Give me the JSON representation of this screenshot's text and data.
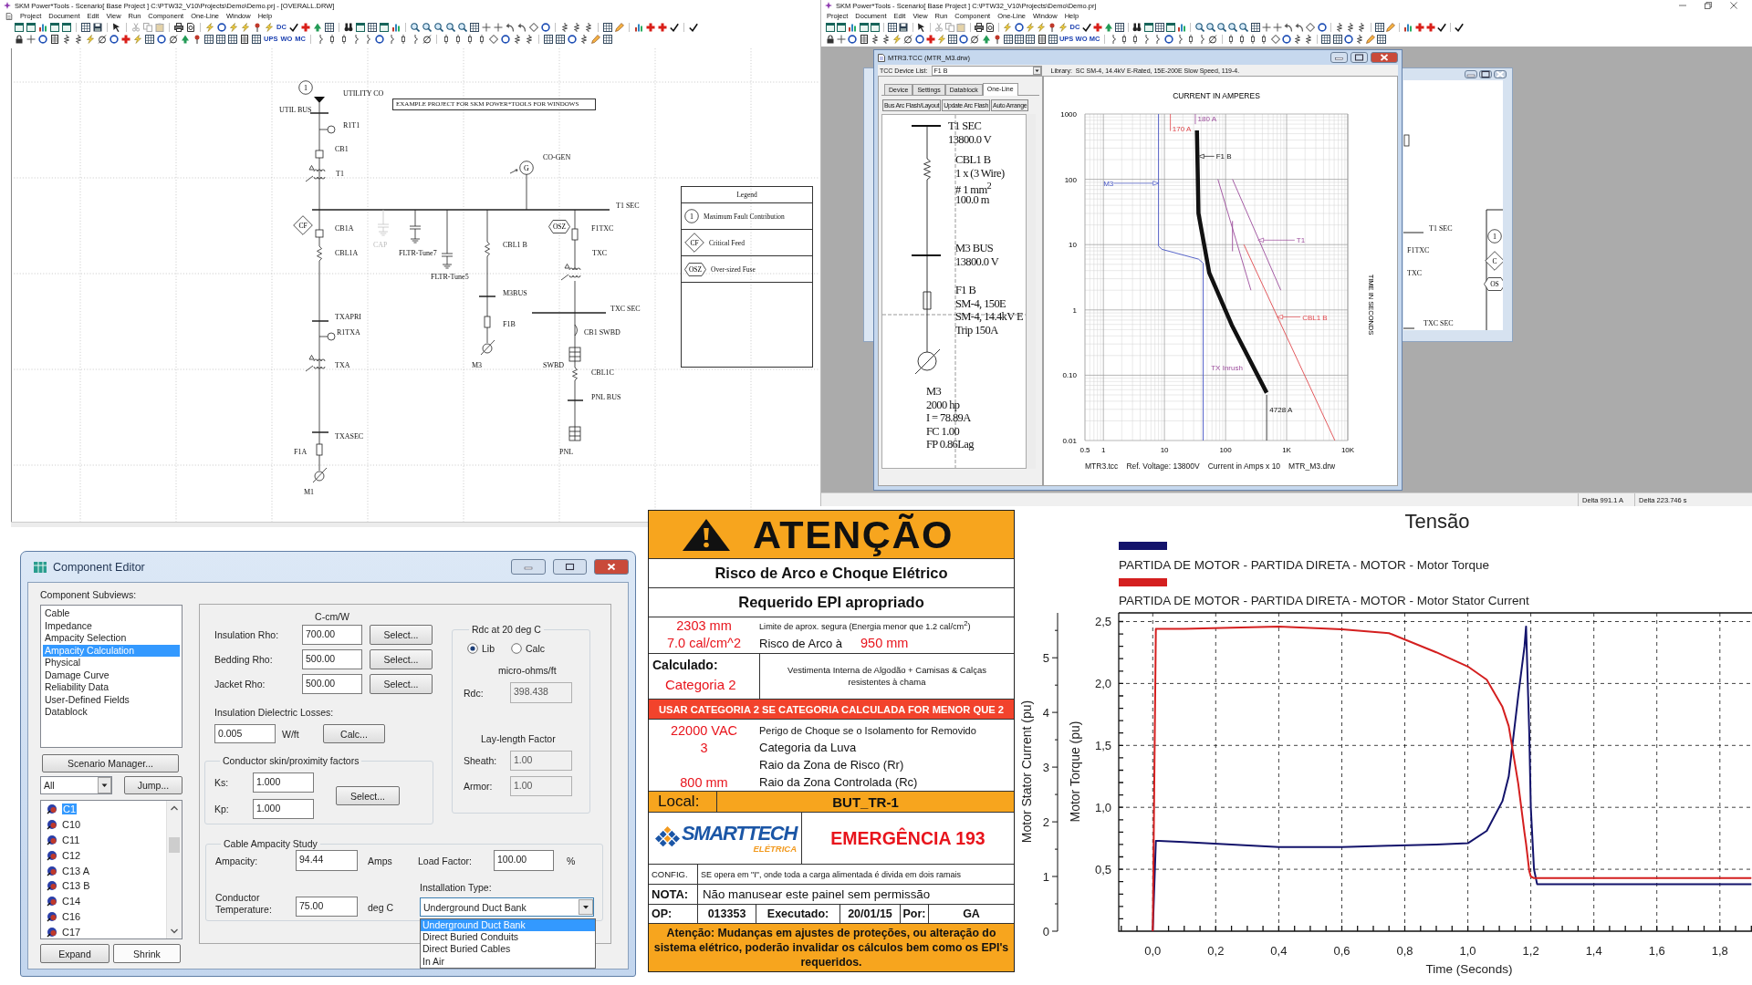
{
  "one_line_window": {
    "title": "SKM Power*Tools - Scenario[ Base Project ] C:\\PTW32_V10\\Projects\\Demo\\Demo.prj - [OVERALL.DRW]",
    "menu": [
      "Project",
      "Document",
      "Edit",
      "View",
      "Run",
      "Component",
      "One-Line",
      "Window",
      "Help"
    ],
    "toolbar": {
      "row_1_text_buttons": [
        "DC"
      ],
      "row_2_text_buttons": [
        "UPS",
        "WO",
        "MC"
      ]
    },
    "note": "EXAMPLE PROJECT FOR SKM POWER*TOOLS FOR WINDOWS",
    "tags": [
      {
        "kind": "fault",
        "text": "1"
      },
      {
        "kind": "critical",
        "text": "CF"
      },
      {
        "kind": "oversized",
        "text": "OSZ"
      },
      {
        "kind": "generator",
        "text": "G"
      }
    ],
    "labels": [
      {
        "text": "UTILITY CO",
        "disabled": false
      },
      {
        "text": "UTIL BUS",
        "disabled": false
      },
      {
        "text": "R1T1",
        "disabled": false
      },
      {
        "text": "CB1",
        "disabled": false
      },
      {
        "text": "T1",
        "disabled": false
      },
      {
        "text": "CO-GEN",
        "disabled": false
      },
      {
        "text": "T1 SEC",
        "disabled": false
      },
      {
        "text": "CB1A",
        "disabled": false
      },
      {
        "text": "CBL1A",
        "disabled": false
      },
      {
        "text": "CAP",
        "disabled": true
      },
      {
        "text": "FLTR-Tune7",
        "disabled": false
      },
      {
        "text": "FLTR-Tune5",
        "disabled": false
      },
      {
        "text": "CBL1 B",
        "disabled": false
      },
      {
        "text": "M3BUS",
        "disabled": false
      },
      {
        "text": "F1B",
        "disabled": false
      },
      {
        "text": "M3",
        "disabled": false
      },
      {
        "text": "F1TXC",
        "disabled": false
      },
      {
        "text": "TXC",
        "disabled": false
      },
      {
        "text": "TXC SEC",
        "disabled": false
      },
      {
        "text": "CB1 SWBD",
        "disabled": false
      },
      {
        "text": "SWBD",
        "disabled": false
      },
      {
        "text": "CBL1C",
        "disabled": false
      },
      {
        "text": "PNL BUS",
        "disabled": false
      },
      {
        "text": "PNL",
        "disabled": false
      },
      {
        "text": "TXAPRI",
        "disabled": false
      },
      {
        "text": "R1TXA",
        "disabled": false
      },
      {
        "text": "TXA",
        "disabled": false
      },
      {
        "text": "TXASEC",
        "disabled": false
      },
      {
        "text": "F1A",
        "disabled": false
      },
      {
        "text": "M1",
        "disabled": false
      }
    ],
    "legend": {
      "title": "Legend",
      "items": [
        {
          "kind": "fault",
          "tag": "1",
          "text": "Maximum Fault Contribution"
        },
        {
          "kind": "critical",
          "tag": "CF",
          "text": "Critical Feed"
        },
        {
          "kind": "oversized",
          "tag": "OSZ",
          "text": "Over-sized Fuse"
        }
      ]
    }
  },
  "tcc_window": {
    "title": "SKM Power*Tools - Scenario[ Base Project ] C:\\PTW32_V10\\Projects\\Demo\\Demo.prj",
    "menu": [
      "Project",
      "Document",
      "Edit",
      "View",
      "Run",
      "Component",
      "One-Line",
      "Window",
      "Help"
    ],
    "toolbar": {
      "row_1_text_buttons": [
        "DC"
      ],
      "row_2_text_buttons": [
        "UPS",
        "WO",
        "MC"
      ]
    },
    "side_window": {
      "labels": [
        "T1 SEC",
        "F1TXC",
        "TXC",
        "TXC SEC"
      ],
      "tags": [
        {
          "kind": "fault",
          "text": "1"
        },
        {
          "kind": "critical",
          "text": "C"
        },
        {
          "kind": "oversized",
          "text": "OS"
        }
      ]
    },
    "tcc": {
      "title": "MTR3.TCC (MTR_M3.drw)",
      "device_list_label": "TCC Device List:",
      "device": "F1 B",
      "library_label": "Library:",
      "library": "SC SM-4, 14.4kV E-Rated, 15E-200E Slow Speed, 119-4.",
      "tabs": [
        {
          "label": "Device",
          "selected": false
        },
        {
          "label": "Settings",
          "selected": false
        },
        {
          "label": "Datablock",
          "selected": false
        },
        {
          "label": "One-Line",
          "selected": true
        }
      ],
      "buttons": [
        "Bus Arc Flash/Layout",
        "Update Arc Flash",
        "Auto Arrange"
      ],
      "one_line": [
        {
          "kind": "bus",
          "lines": [
            "T1 SEC",
            "13800.0 V"
          ]
        },
        {
          "kind": "cable",
          "lines": [
            "CBL1 B",
            "1 x (3 Wire)",
            "# 1 mm$^{2}$",
            "100.0 m"
          ]
        },
        {
          "kind": "bus",
          "lines": [
            "M3 BUS",
            "13800.0 V"
          ]
        },
        {
          "kind": "fuse",
          "lines": [
            "F1 B",
            "SM-4, 150E",
            "SM-4, 14.4kV E",
            "Trip 150A"
          ]
        },
        {
          "kind": "motor",
          "lines": [
            "M3",
            "2000 hp",
            "I = 78.89A",
            "FC 1.00",
            "FP 0.86Lag"
          ]
        }
      ],
      "tcc_plot": {
        "title": "CURRENT IN AMPERES",
        "axis_title": "TIME IN SECONDS",
        "x_tick_labels": [
          "0.5",
          "1",
          "10",
          "100",
          "1K",
          "10K"
        ],
        "y_tick_labels": [
          "1000",
          "100",
          "10",
          "1",
          "0.10",
          "0.01"
        ],
        "curves": [
          {
            "label": "180 A",
            "kind": "marker"
          },
          {
            "label": "170 A",
            "kind": "marker"
          },
          {
            "label": "F1 B",
            "kind": "band"
          },
          {
            "label": "M3",
            "kind": "line"
          },
          {
            "label": "T1",
            "kind": "line"
          },
          {
            "label": "CBL1 B",
            "kind": "line"
          },
          {
            "label": "TX Inrush",
            "kind": "line"
          },
          {
            "label": "4728 A",
            "kind": "marker"
          }
        ]
      },
      "footer": [
        "MTR3.tcc",
        "Ref. Voltage: 13800V",
        "Current in Amps x 10",
        "MTR_M3.drw"
      ]
    },
    "status_bar": [
      "Delta 991.1 A",
      "Delta 223.746 s"
    ]
  },
  "component_editor": {
    "title": "Component Editor",
    "subviews_label": "Component Subviews:",
    "subviews": [
      {
        "label": "Cable",
        "selected": false
      },
      {
        "label": "Impedance",
        "selected": false
      },
      {
        "label": "Ampacity Selection",
        "selected": false
      },
      {
        "label": "Ampacity Calculation",
        "selected": true
      },
      {
        "label": "Physical",
        "selected": false
      },
      {
        "label": "Damage Curve",
        "selected": false
      },
      {
        "label": "Reliability Data",
        "selected": false
      },
      {
        "label": "User-Defined Fields",
        "selected": false
      },
      {
        "label": "Datablock",
        "selected": false
      }
    ],
    "scenario_button": "Scenario Manager...",
    "filter": "All",
    "jump_button": "Jump...",
    "components": [
      {
        "label": "C1",
        "selected": true
      },
      {
        "label": "C10",
        "selected": false
      },
      {
        "label": "C11",
        "selected": false
      },
      {
        "label": "C12",
        "selected": false
      },
      {
        "label": "C13 A",
        "selected": false
      },
      {
        "label": "C13 B",
        "selected": false
      },
      {
        "label": "C14",
        "selected": false
      },
      {
        "label": "C16",
        "selected": false
      },
      {
        "label": "C17",
        "selected": false
      }
    ],
    "expand_button": "Expand",
    "shrink_button": "Shrink",
    "unit_header": "C-cm/W",
    "rho_rows": [
      {
        "label": "Insulation Rho:",
        "value": "700.00",
        "button": "Select..."
      },
      {
        "label": "Bedding Rho:",
        "value": "500.00",
        "button": "Select..."
      },
      {
        "label": "Jacket Rho:",
        "value": "500.00",
        "button": "Select..."
      }
    ],
    "dielectric": {
      "label": "Insulation Dielectric Losses:",
      "value": "0.005",
      "unit": "W/ft",
      "button": "Calc..."
    },
    "skin_group": {
      "title": "Conductor skin/proximity factors",
      "rows": [
        {
          "label": "Ks:",
          "value": "1.000"
        },
        {
          "label": "Kp:",
          "value": "1.000"
        }
      ],
      "button": "Select..."
    },
    "rdc_group": {
      "title": "Rdc at 20 deg C",
      "options": [
        {
          "label": "Lib",
          "selected": true
        },
        {
          "label": "Calc",
          "selected": false
        }
      ],
      "unit": "micro-ohms/ft",
      "rdc": {
        "label": "Rdc:",
        "value": "398.438",
        "disabled": true
      },
      "lay_length_title": "Lay-length Factor",
      "lay_rows": [
        {
          "label": "Sheath:",
          "value": "1.00",
          "disabled": true
        },
        {
          "label": "Armor:",
          "value": "1.00",
          "disabled": true
        }
      ]
    },
    "study_group": {
      "title": "Cable Ampacity Study",
      "ampacity": {
        "label": "Ampacity:",
        "value": "94.44",
        "unit": "Amps"
      },
      "load_factor": {
        "label": "Load Factor:",
        "value": "100.00",
        "unit": "%"
      },
      "temperature": {
        "label": "Conductor Temperature:",
        "value": "75.00",
        "unit": "deg C"
      },
      "installation": {
        "label": "Installation Type:",
        "value": "Underground Duct Bank",
        "expanded": true,
        "options": [
          {
            "label": "Underground Duct Bank",
            "selected": true
          },
          {
            "label": "Direct Buried Conduits",
            "selected": false
          },
          {
            "label": "Direct Buried Cables",
            "selected": false
          },
          {
            "label": "In Air",
            "selected": false
          }
        ]
      }
    }
  },
  "arc_flash_label": {
    "header": "ATENÇÃO",
    "subtitle": "Risco de Arco e Choque Elétrico",
    "ppe_title": "Requerido EPI apropriado",
    "boundary": {
      "value": "2303 mm",
      "text": "Limite de aprox. segura (Energia menor que 1.2 cal/cm$^{2}$)"
    },
    "incident_energy": {
      "value": "7.0 cal/cm^2",
      "text": "Risco de Arco à",
      "distance": "950 mm"
    },
    "category": {
      "label": "Calculado:",
      "value": "Categoria 2",
      "clothing": "Vestimenta Interna de Algodão + Camisas & Calças resistentes à chama"
    },
    "warning_bar": "USAR CATEGORIA 2 SE CATEGORIA CALCULADA FOR MENOR QUE 2",
    "shock_rows": [
      {
        "value": "22000 VAC",
        "text": "Perigo de Choque se o Isolamento for Removido"
      },
      {
        "value": "3",
        "text": "Categoria da Luva"
      },
      {
        "text": "Raio da Zona de Risco (Rr)"
      },
      {
        "value": "800 mm",
        "text": "Raio da Zona Controlada (Rc)"
      }
    ],
    "location": {
      "label": "Local:",
      "value": "BUT_TR-1"
    },
    "logo": {
      "name": "SMARTTECH",
      "subtitle": "ELÉTRICA"
    },
    "emergency": "EMERGÊNCIA 193",
    "config": {
      "label": "CONFIG.",
      "text": "SE opera em \"I\", onde toda a carga alimentada é divida em dois ramais"
    },
    "note": {
      "label": "NOTA:",
      "text": "Não manusear este painel sem permissão"
    },
    "op_row": [
      "OP:",
      "013353",
      "Executado:",
      "20/01/15",
      "Por:",
      "GA"
    ],
    "footer": "Atenção: Mudanças em ajustes de proteções, ou alteração do sistema elétrico, poderão invalidar os cálculos bem como os EPI's requeridos."
  },
  "motor_start_chart": {
    "chart_data": {
      "type": "line",
      "title": "Tensão",
      "xlabel": "Time (Seconds)",
      "ylabel": "Motor Torque (pu)",
      "y2label": "Motor Stator Current (pu)",
      "legend": "top",
      "grid": true,
      "x": [
        0,
        0.01,
        0.1,
        0.4,
        0.6,
        0.75,
        0.9,
        1.0,
        1.06,
        1.11,
        1.13,
        1.16,
        1.18,
        1.185,
        1.195,
        1.2,
        1.21,
        1.22,
        1.5,
        1.9
      ],
      "series": [
        {
          "name": "PARTIDA DE MOTOR - PARTIDA DIRETA - MOTOR - Motor Torque",
          "color": "#13136b",
          "axis": "y",
          "values": [
            0,
            0.73,
            0.72,
            0.68,
            0.68,
            0.69,
            0.7,
            0.71,
            0.81,
            1.05,
            1.25,
            1.9,
            2.3,
            2.46,
            1.6,
            1.0,
            0.5,
            0.38,
            0.38,
            0.38
          ]
        },
        {
          "name": "PARTIDA DE MOTOR - PARTIDA DIRETA - MOTOR - Motor Stator Current",
          "color": "#d41f1f",
          "axis": "y2",
          "values": [
            0,
            5.53,
            5.53,
            5.57,
            5.52,
            5.45,
            5.1,
            4.84,
            4.6,
            4.1,
            3.75,
            2.7,
            1.8,
            1.6,
            1.1,
            1.0,
            0.97,
            0.97,
            0.97,
            0.97
          ]
        }
      ],
      "xlim": [
        -0.108,
        1.902
      ],
      "ylim": [
        0,
        2.57
      ],
      "y2lim": [
        0,
        5.82
      ],
      "xticks": [
        {
          "value": 0,
          "label": "0,0"
        },
        {
          "value": 0.2,
          "label": "0,2"
        },
        {
          "value": 0.4,
          "label": "0,4"
        },
        {
          "value": 0.6,
          "label": "0,6"
        },
        {
          "value": 0.8,
          "label": "0,8"
        },
        {
          "value": 1.0,
          "label": "1,0"
        },
        {
          "value": 1.2,
          "label": "1,2"
        },
        {
          "value": 1.4,
          "label": "1,4"
        },
        {
          "value": 1.6,
          "label": "1,6"
        },
        {
          "value": 1.8,
          "label": "1,8"
        }
      ],
      "yticks": [
        {
          "value": 0.5,
          "label": "0,5"
        },
        {
          "value": 1.0,
          "label": "1,0"
        },
        {
          "value": 1.5,
          "label": "1,5"
        },
        {
          "value": 2.0,
          "label": "2,0"
        },
        {
          "value": 2.5,
          "label": "2,5"
        }
      ],
      "y2ticks": [
        0,
        1,
        2,
        3,
        4,
        5
      ]
    }
  }
}
